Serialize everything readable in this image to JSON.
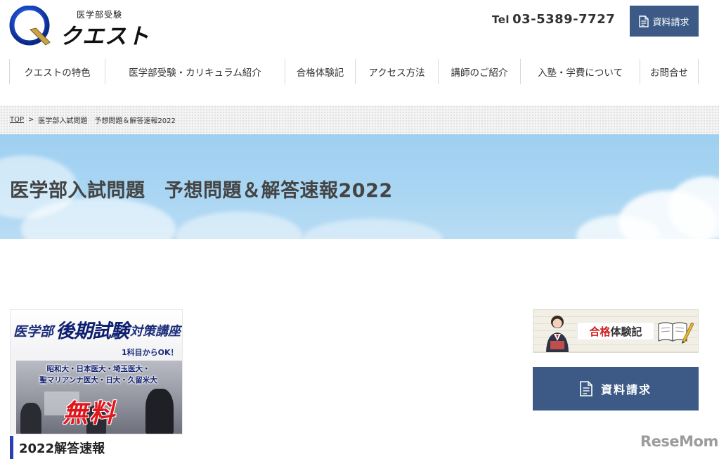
{
  "header": {
    "logo_sub": "医学部受験",
    "logo_main": "クエスト",
    "tel_prefix": "Tel",
    "tel_number": "03-5389-7727",
    "request_label": "資料請求"
  },
  "nav": {
    "items": [
      {
        "label": "クエストの特色"
      },
      {
        "label": "医学部受験・カリキュラム紹介"
      },
      {
        "label": "合格体験記"
      },
      {
        "label": "アクセス方法"
      },
      {
        "label": "講師のご紹介"
      },
      {
        "label": "入塾・学費について"
      },
      {
        "label": "お問合せ"
      }
    ]
  },
  "breadcrumb": {
    "home": "TOP",
    "separator": ">",
    "current": "医学部入試問題　予想問題＆解答速報2022"
  },
  "hero": {
    "title": "医学部入試問題　予想問題＆解答速報2022"
  },
  "banner": {
    "t1": "医学部",
    "t2": "後期試験",
    "t3": "対策講座",
    "t4": "1科目からOK！",
    "schools_line1": "昭和大・日本医大・埼玉医大・",
    "schools_line2": "聖マリアンナ医大・日大・久留米大",
    "free": "無料"
  },
  "section": {
    "heading": "2022解答速報"
  },
  "sidebar": {
    "experience_prefix": "合格",
    "experience_suffix": "体験記",
    "request_label": "資料請求"
  },
  "watermark": {
    "text": "ReseMom"
  },
  "colors": {
    "accent_blue": "#3c5a85",
    "heading_bar": "#2b3fb0",
    "free_red": "#e0161d"
  }
}
